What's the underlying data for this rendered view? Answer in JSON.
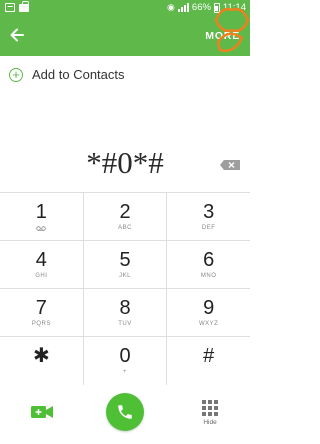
{
  "status": {
    "battery": "66%",
    "time": "11:14"
  },
  "header": {
    "more_label": "MORE"
  },
  "add_contacts": {
    "label": "Add to Contacts"
  },
  "dialer": {
    "number": "*#0*#"
  },
  "keys": [
    [
      {
        "digit": "1",
        "letters": ""
      },
      {
        "digit": "2",
        "letters": "ABC"
      },
      {
        "digit": "3",
        "letters": "DEF"
      }
    ],
    [
      {
        "digit": "4",
        "letters": "GHI"
      },
      {
        "digit": "5",
        "letters": "JKL"
      },
      {
        "digit": "6",
        "letters": "MNO"
      }
    ],
    [
      {
        "digit": "7",
        "letters": "PQRS"
      },
      {
        "digit": "8",
        "letters": "TUV"
      },
      {
        "digit": "9",
        "letters": "WXYZ"
      }
    ],
    [
      {
        "digit": "✱",
        "letters": ""
      },
      {
        "digit": "0",
        "letters": "+"
      },
      {
        "digit": "#",
        "letters": ""
      }
    ]
  ],
  "bottom": {
    "hide_label": "Hide"
  },
  "colors": {
    "header_green": "#5fb84a",
    "call_green": "#4fbf36",
    "overlay_orange": "#f07f1e"
  },
  "icons": {
    "back": "arrow-left-icon",
    "video_call": "video-camera-icon",
    "call": "phone-icon",
    "hide": "dialpad-icon",
    "delete": "backspace-icon",
    "voicemail": "voicemail-icon"
  }
}
